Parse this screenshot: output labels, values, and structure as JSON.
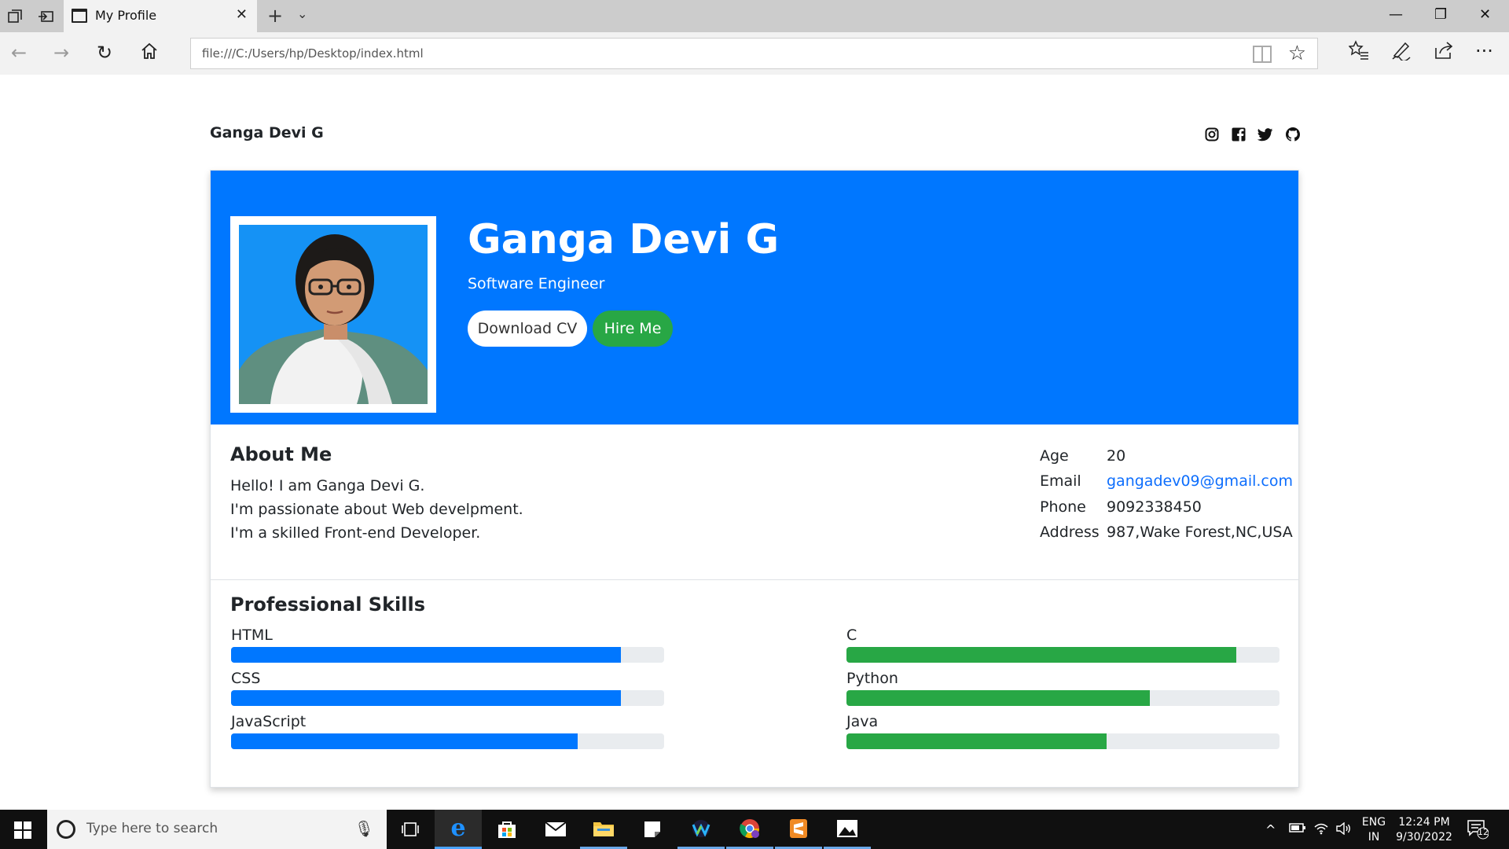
{
  "browser": {
    "tab_title": "My Profile",
    "new_tab": "+",
    "tab_list": "⌄",
    "url": "file:///C:/Users/hp/Desktop/index.html",
    "controls": {
      "minimize": "—",
      "restore": "❐",
      "close": "✕"
    }
  },
  "page": {
    "brand": "Ganga Devi G",
    "social": [
      "instagram-icon",
      "facebook-icon",
      "twitter-icon",
      "github-icon"
    ],
    "hero": {
      "name": "Ganga Devi G",
      "role": "Software Engineer",
      "download_label": "Download CV",
      "hire_label": "Hire Me"
    },
    "about": {
      "title": "About Me",
      "lines": [
        "Hello! I am Ganga Devi G.",
        "I'm passionate about Web develpment.",
        "I'm a skilled Front-end Developer."
      ],
      "info": [
        {
          "label": "Age",
          "value": "20"
        },
        {
          "label": "Email",
          "value": "gangadev09@gmail.com"
        },
        {
          "label": "Phone",
          "value": "9092338450"
        },
        {
          "label": "Address",
          "value": "987,Wake Forest,NC,USA"
        }
      ]
    },
    "skills": {
      "title": "Professional Skills",
      "left": [
        {
          "name": "HTML",
          "percent": 90
        },
        {
          "name": "CSS",
          "percent": 90
        },
        {
          "name": "JavaScript",
          "percent": 80
        }
      ],
      "right": [
        {
          "name": "C",
          "percent": 90
        },
        {
          "name": "Python",
          "percent": 70
        },
        {
          "name": "Java",
          "percent": 60
        }
      ]
    }
  },
  "taskbar": {
    "search_placeholder": "Type here to search",
    "lang_top": "ENG",
    "lang_bottom": "IN",
    "time": "12:24 PM",
    "date": "9/30/2022",
    "notification_count": "12"
  },
  "colors": {
    "hero_blue": "#0077ff",
    "green": "#28a745",
    "link": "#0d6efd"
  }
}
